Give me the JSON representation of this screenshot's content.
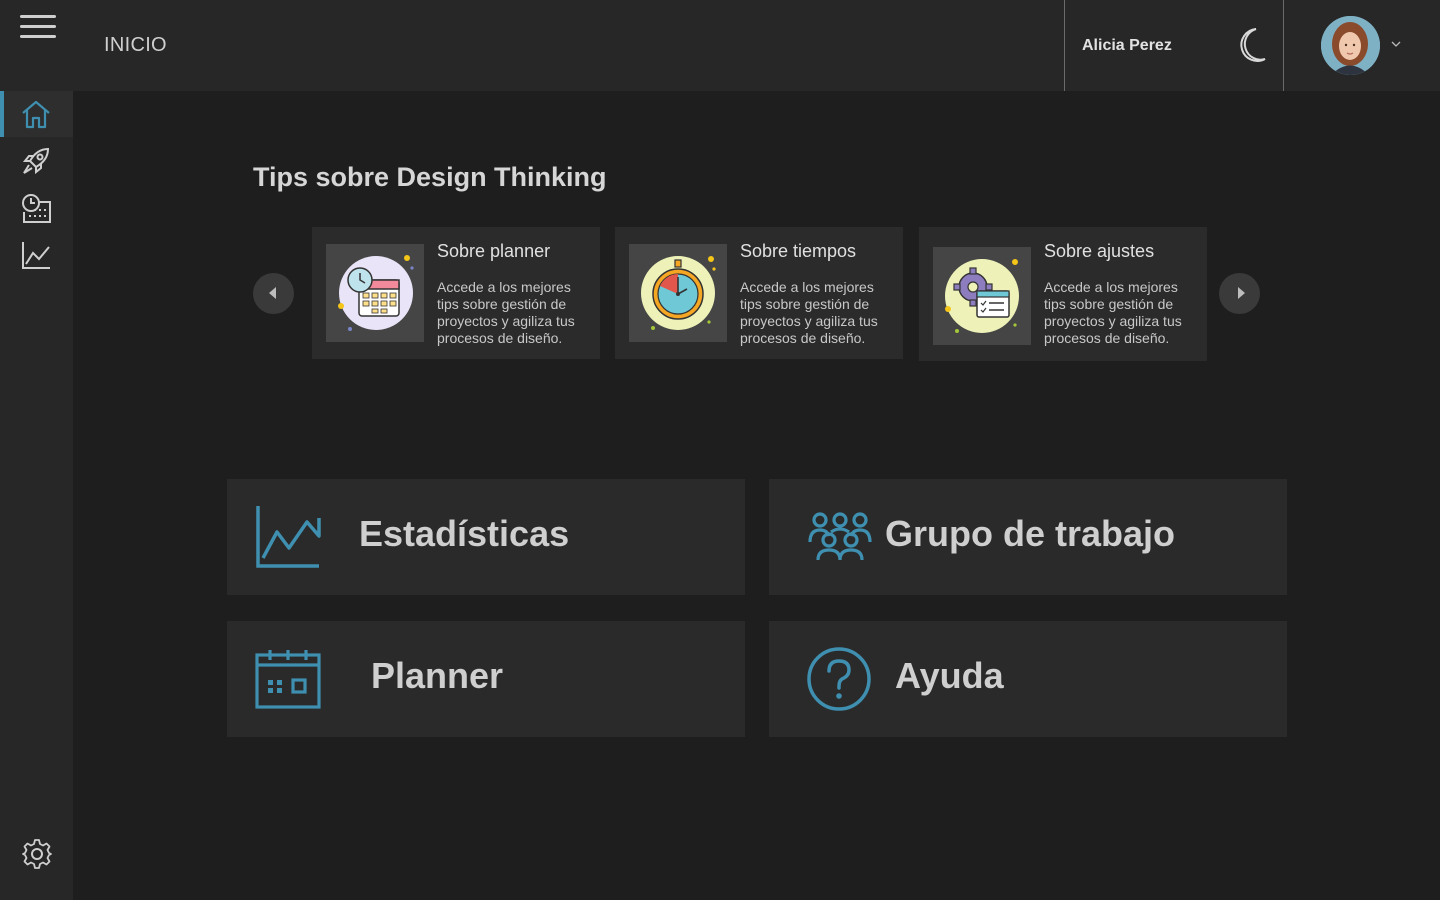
{
  "header": {
    "page_title": "INICIO",
    "user_name": "Alicia Perez",
    "icons": [
      "hamburger-icon",
      "moon-icon",
      "chevron-down-icon"
    ]
  },
  "sidebar": {
    "items": [
      {
        "icon": "home-icon",
        "active": true
      },
      {
        "icon": "rocket-icon",
        "active": false
      },
      {
        "icon": "schedule-icon",
        "active": false
      },
      {
        "icon": "chart-line-icon",
        "active": false
      }
    ],
    "footer_icon": "gear-icon"
  },
  "tips": {
    "title": "Tips sobre Design Thinking",
    "cards": [
      {
        "title": "Sobre planner",
        "text": "Accede a los mejores tips sobre gestión de proyectos y agiliza tus procesos de diseño.",
        "icon": "calendar-clock-icon"
      },
      {
        "title": "Sobre tiempos",
        "text": "Accede a los mejores tips sobre gestión de proyectos y agiliza tus procesos de diseño.",
        "icon": "stopwatch-icon"
      },
      {
        "title": "Sobre ajustes",
        "text": "Accede a los mejores tips sobre gestión de proyectos y agiliza tus procesos de diseño.",
        "icon": "gear-checklist-icon"
      }
    ]
  },
  "tiles": [
    {
      "label": "Estadísticas",
      "icon": "chart-line-icon"
    },
    {
      "label": "Grupo de trabajo",
      "icon": "group-icon"
    },
    {
      "label": "Planner",
      "icon": "calendar-icon"
    },
    {
      "label": "Ayuda",
      "icon": "help-icon"
    }
  ],
  "colors": {
    "background": "#1e1e1e",
    "panel": "#272727",
    "accent": "#3f8fb0",
    "text": "#cfcfcf"
  }
}
